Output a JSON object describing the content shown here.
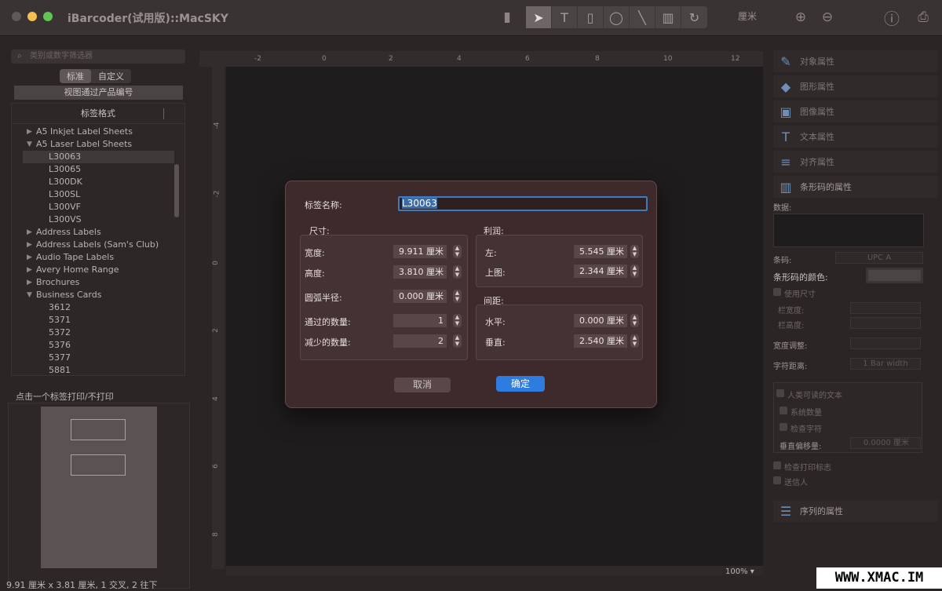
{
  "window": {
    "title": "iBarcoder(试用版)::MacSKY",
    "unit_label": "厘米"
  },
  "sidebar": {
    "search_placeholder": "类别或数字筛选器",
    "tabs": [
      {
        "label": "标准"
      },
      {
        "label": "自定义"
      }
    ],
    "view_by_product": "视图通过产品编号",
    "list_header": "标签格式",
    "tree": [
      {
        "label": "A5 Inkjet Label Sheets"
      },
      {
        "label": "A5 Laser Label Sheets"
      },
      {
        "label": "L30063"
      },
      {
        "label": "L30065"
      },
      {
        "label": "L300DK"
      },
      {
        "label": "L300SL"
      },
      {
        "label": "L300VF"
      },
      {
        "label": "L300VS"
      },
      {
        "label": "Address Labels"
      },
      {
        "label": "Address Labels (Sam's Club)"
      },
      {
        "label": "Audio Tape Labels"
      },
      {
        "label": "Avery Home Range"
      },
      {
        "label": "Brochures"
      },
      {
        "label": "Business Cards"
      },
      {
        "label": "3612"
      },
      {
        "label": "5371"
      },
      {
        "label": "5372"
      },
      {
        "label": "5376"
      },
      {
        "label": "5377"
      },
      {
        "label": "5881"
      }
    ],
    "print_toggle_label": "点击一个标签打印/不打印",
    "status": "9.91 厘米 x 3.81 厘米, 1 交叉, 2 往下"
  },
  "ruler": {
    "h_ticks": [
      "-2",
      "0",
      "2",
      "4",
      "6",
      "8",
      "10",
      "12"
    ],
    "v_ticks": [
      "-4",
      "-2",
      "0",
      "2",
      "4",
      "6",
      "8"
    ]
  },
  "zoom": "100%",
  "right_panel": {
    "sections": [
      {
        "label": "对象属性"
      },
      {
        "label": "图形属性"
      },
      {
        "label": "图像属性"
      },
      {
        "label": "文本属性"
      },
      {
        "label": "对齐属性"
      },
      {
        "label": "条形码的属性"
      }
    ],
    "data_label": "数据:",
    "barcode_label": "条码:",
    "barcode_value": "UPC A",
    "barcode_color_label": "条形码的颜色:",
    "use_size_label": "使用尺寸",
    "bar_width_label": "栏宽度:",
    "bar_height_label": "栏高度:",
    "width_adjust_label": "宽度调整:",
    "char_spacing_label": "字符距离:",
    "char_spacing_value": "1 Bar width",
    "human_readable_label": "人类可读的文本",
    "system_number_label": "系统数量",
    "check_char_label": "检查字符",
    "vertical_offset_label": "垂直偏移量:",
    "vertical_offset_value": "0.0000 厘米",
    "check_print_flag_label": "检查打印标志",
    "sender_label": "送信人",
    "sequence_label": "序列的属性"
  },
  "dialog": {
    "name_label": "标签名称:",
    "name_value": "L30063",
    "size_title": "尺寸:",
    "width_label": "宽度:",
    "width_value": "9.911 厘米",
    "height_label": "高度:",
    "height_value": "3.810 厘米",
    "radius_label": "圆弧半径:",
    "radius_value": "0.000 厘米",
    "across_label": "通过的数量:",
    "across_value": "1",
    "down_label": "减少的数量:",
    "down_value": "2",
    "margin_title": "利润:",
    "left_label": "左:",
    "left_value": "5.545 厘米",
    "top_label": "上图:",
    "top_value": "2.344 厘米",
    "spacing_title": "间距:",
    "horizontal_label": "水平:",
    "horizontal_value": "0.000 厘米",
    "vertical_label": "垂直:",
    "vertical_value": "2.540 厘米",
    "cancel": "取消",
    "ok": "确定"
  },
  "watermark": "WWW.XMAC.IM"
}
